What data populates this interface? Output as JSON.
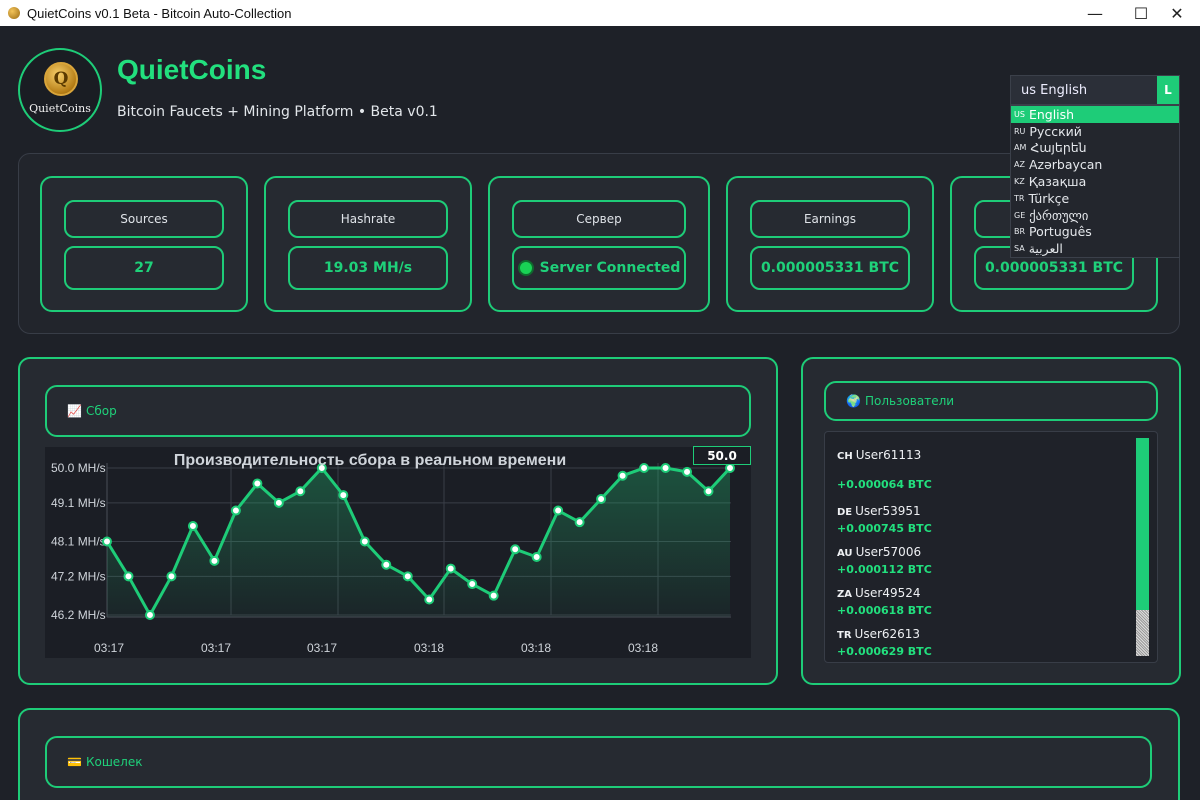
{
  "window": {
    "title": "QuietCoins v0.1 Beta - Bitcoin Auto-Collection",
    "minimize_glyph": "—",
    "maximize_glyph": "☐",
    "close_glyph": "✕"
  },
  "header": {
    "logo_text": "QuietCoins",
    "logo_letter": "Q",
    "app_name": "QuietCoins",
    "subtitle": "Bitcoin Faucets + Mining Platform • Beta v0.1"
  },
  "language": {
    "selected": "us English",
    "button_glyph": "L",
    "options": [
      {
        "code": "US",
        "label": "English"
      },
      {
        "code": "RU",
        "label": "Русский"
      },
      {
        "code": "AM",
        "label": "Հայերեն"
      },
      {
        "code": "AZ",
        "label": "Azərbaycan"
      },
      {
        "code": "KZ",
        "label": "Қазақша"
      },
      {
        "code": "TR",
        "label": "Türkçe"
      },
      {
        "code": "GE",
        "label": "ქართული"
      },
      {
        "code": "BR",
        "label": "Português"
      },
      {
        "code": "SA",
        "label": "العربية"
      }
    ]
  },
  "stats": [
    {
      "label": "Sources",
      "value": "27"
    },
    {
      "label": "Hashrate",
      "value": "19.03 MH/s"
    },
    {
      "label": "Сервер",
      "value": "Server Connected"
    },
    {
      "label": "Earnings",
      "value": "0.000005331 BTC"
    },
    {
      "label": "",
      "value": "0.000005331 BTC"
    }
  ],
  "collection": {
    "header": "Сбор",
    "icon": "📈"
  },
  "chart_data": {
    "type": "line",
    "title": "Производительность сбора в реальном времени",
    "current_value": "50.0",
    "xlabel": "",
    "ylabel": "",
    "y_tick_labels": [
      "50.0 MH/s",
      "49.1 MH/s",
      "48.1 MH/s",
      "47.2 MH/s",
      "46.2 MH/s"
    ],
    "y_ticks": [
      50.0,
      49.1,
      48.1,
      47.2,
      46.2
    ],
    "x_tick_labels": [
      "03:17",
      "03:17",
      "03:17",
      "03:18",
      "03:18",
      "03:18"
    ],
    "ylim": [
      46.2,
      50.0
    ],
    "grid": true,
    "color": "#1ecc78",
    "values": [
      48.1,
      47.2,
      46.2,
      47.2,
      48.5,
      47.6,
      48.9,
      49.6,
      49.1,
      49.4,
      50.0,
      49.3,
      48.1,
      47.5,
      47.2,
      46.6,
      47.4,
      47.0,
      46.7,
      47.9,
      47.7,
      48.9,
      48.6,
      49.2,
      49.8,
      50.0,
      50.0,
      49.9,
      49.4,
      50.0
    ]
  },
  "users": {
    "header": "Пользователи",
    "icon": "🌍",
    "items": [
      {
        "country": "CH",
        "name": "User61113",
        "amount": "+0.000064 BTC"
      },
      {
        "country": "DE",
        "name": "User53951",
        "amount": "+0.000745 BTC"
      },
      {
        "country": "AU",
        "name": "User57006",
        "amount": "+0.000112 BTC"
      },
      {
        "country": "ZA",
        "name": "User49524",
        "amount": "+0.000618 BTC"
      },
      {
        "country": "TR",
        "name": "User62613",
        "amount": "+0.000629 BTC"
      }
    ]
  },
  "wallet": {
    "header": "Кошелек",
    "icon": "💳"
  }
}
